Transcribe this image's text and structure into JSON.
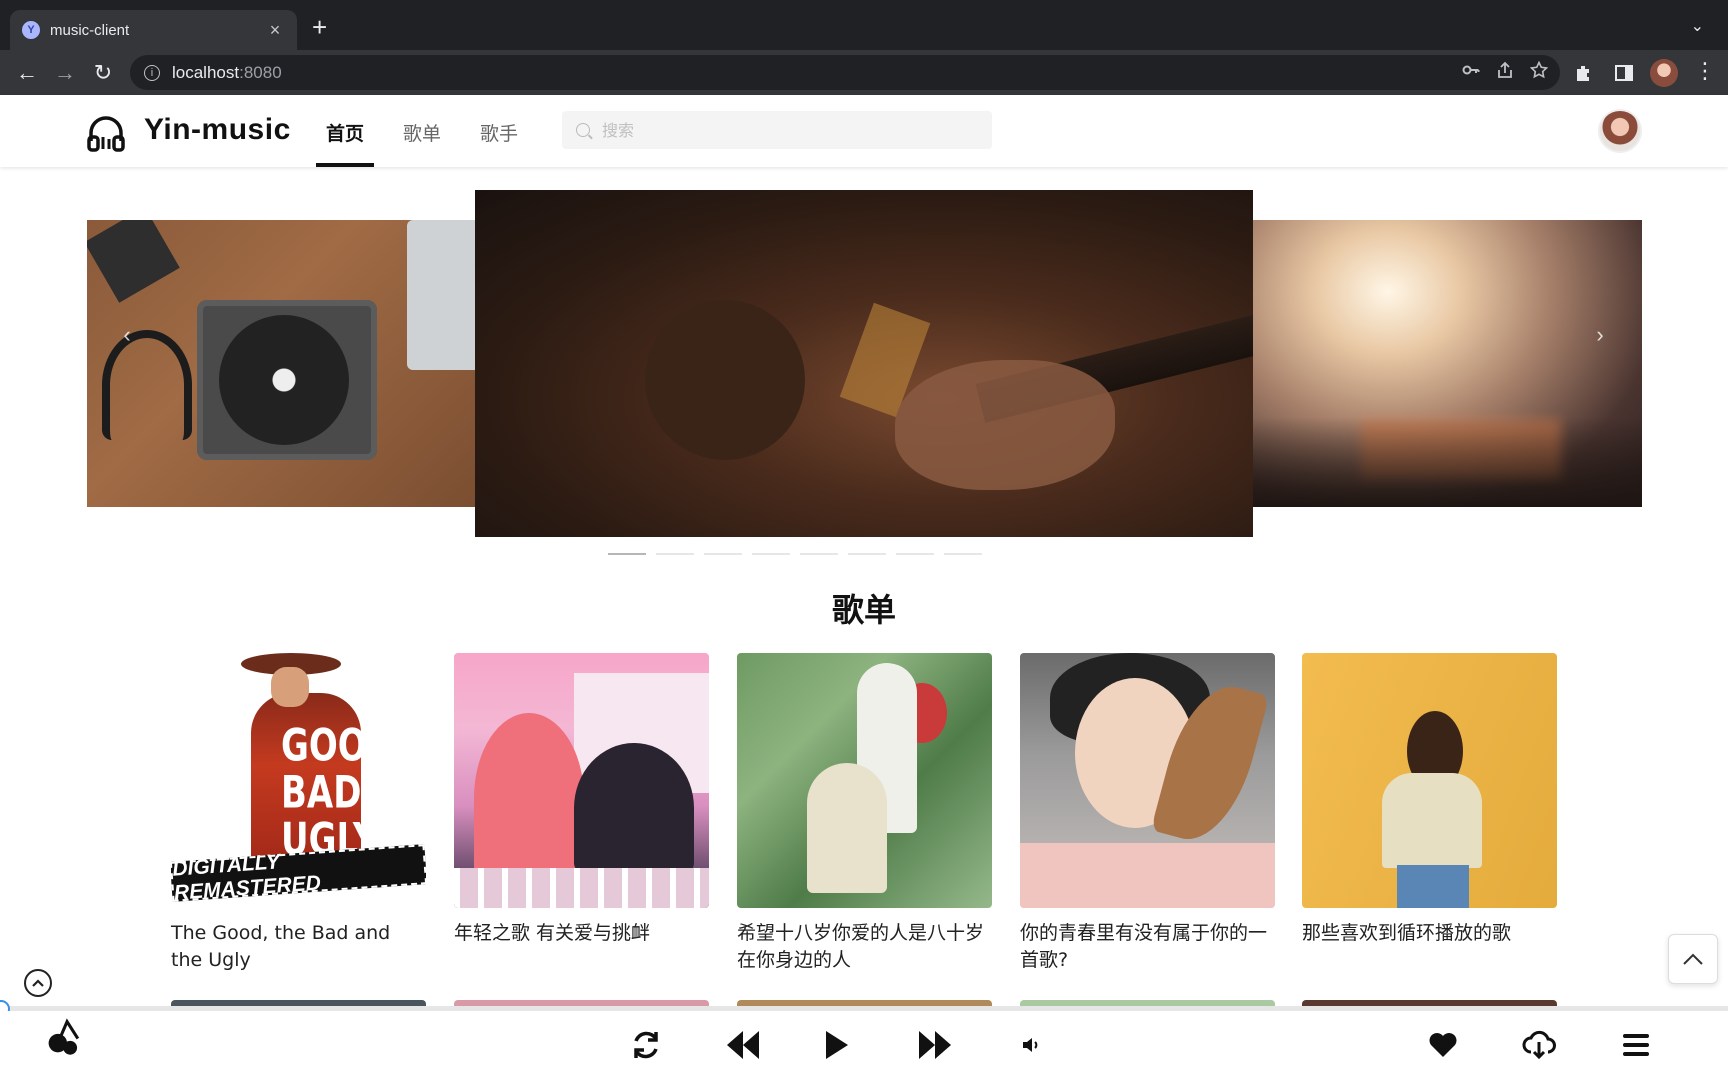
{
  "browser": {
    "tab_title": "music-client",
    "favicon_letter": "Y",
    "tab_close": "×",
    "new_tab": "+",
    "tab_menu": "⌄",
    "url_host": "localhost",
    "url_port": ":8080",
    "back": "←",
    "forward": "→",
    "reload": "↻"
  },
  "header": {
    "logo_text": "Yin-music",
    "nav": [
      {
        "label": "首页",
        "active": true
      },
      {
        "label": "歌单",
        "active": false
      },
      {
        "label": "歌手",
        "active": false
      }
    ],
    "search_placeholder": "搜索"
  },
  "carousel": {
    "prev_arrow": "‹",
    "next_arrow": "›",
    "slide_count": 8,
    "active_index": 0
  },
  "playlists": {
    "section_title": "歌单",
    "cover_text_c1_big": "GOOD\nBAD\nUGLY",
    "cover_text_c1_band": "DIGITALLY REMASTERED",
    "items": [
      {
        "title": "The Good, the Bad and the Ugly"
      },
      {
        "title": "年轻之歌 有关爱与挑衅"
      },
      {
        "title": "希望十八岁你爱的人是八十岁在你身边的人"
      },
      {
        "title": "你的青春里有没有属于你的一首歌?"
      },
      {
        "title": "那些喜欢到循环播放的歌"
      }
    ]
  },
  "player": {
    "progress": 0,
    "loop_icon": "↻",
    "volume_icon": "🔈",
    "heart_icon": "❤",
    "cloud_icon": "☁"
  },
  "colors": {
    "accent": "#111111",
    "progress_knob": "#3a8ee6"
  }
}
